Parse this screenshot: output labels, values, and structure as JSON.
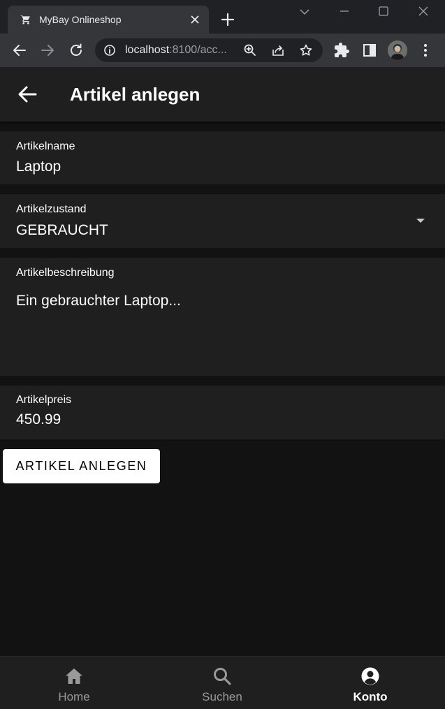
{
  "browser": {
    "tab_title": "MyBay Onlineshop",
    "url_host": "localhost",
    "url_rest": ":8100/acc..."
  },
  "app": {
    "header": {
      "title": "Artikel anlegen"
    },
    "form": {
      "name": {
        "label": "Artikelname",
        "value": "Laptop"
      },
      "condition": {
        "label": "Artikelzustand",
        "value": "GEBRAUCHT"
      },
      "description": {
        "label": "Artikelbeschreibung",
        "value": "Ein gebrauchter Laptop..."
      },
      "price": {
        "label": "Artikelpreis",
        "value": "450.99"
      },
      "submit_label": "ARTIKEL ANLEGEN"
    },
    "tabbar": {
      "items": [
        {
          "label": "Home",
          "icon": "home-icon",
          "active": false
        },
        {
          "label": "Suchen",
          "icon": "search-icon",
          "active": false
        },
        {
          "label": "Konto",
          "icon": "account-icon",
          "active": true
        }
      ]
    }
  }
}
